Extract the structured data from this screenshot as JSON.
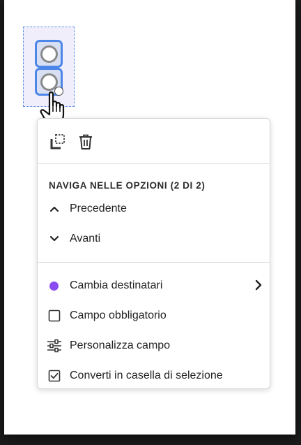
{
  "menu": {
    "section_title": "NAVIGA NELLE OPZIONI (2 DI 2)",
    "previous_label": "Precedente",
    "next_label": "Avanti",
    "change_recipients_label": "Cambia destinatari",
    "required_field_label": "Campo obbligatorio",
    "customize_field_label": "Personalizza campo",
    "convert_label": "Converti in casella di selezione"
  },
  "icons": {
    "copy": "copy-icon",
    "delete": "trash-icon",
    "previous": "chevron-up-icon",
    "next": "chevron-down-icon",
    "recipient": "recipient-dot-icon",
    "submenu": "chevron-right-icon",
    "required": "checkbox-empty-icon",
    "customize": "sliders-icon",
    "convert": "checkbox-checked-icon"
  },
  "colors": {
    "selection_blue": "#4c86e8",
    "recipient_purple": "#8a4cf0",
    "field_background": "#f1eefb"
  }
}
